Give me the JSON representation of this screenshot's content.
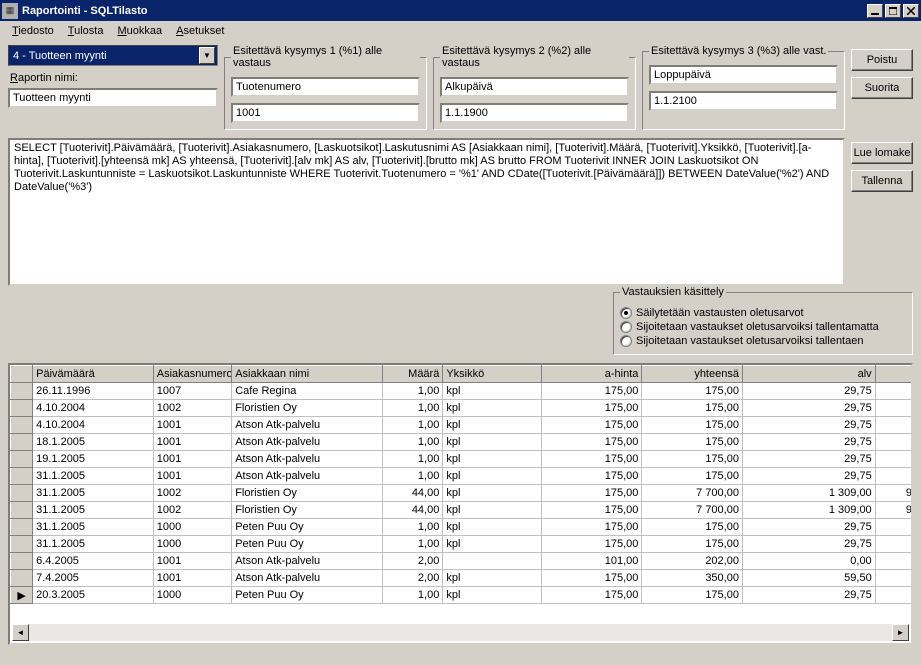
{
  "window": {
    "title": "Raportointi - SQLTilasto"
  },
  "menu": {
    "file": "iedosto",
    "file_u": "T",
    "output": "ulosta",
    "output_u": "T",
    "edit": "uokkaa",
    "edit_u": "M",
    "settings": "setukset",
    "settings_u": "A"
  },
  "report_selector": {
    "value": "4 - Tuotteen myynti"
  },
  "report_name": {
    "label": "aportin nimi:",
    "label_u": "R",
    "value": "Tuotteen myynti"
  },
  "q1": {
    "legend": "Esitettävä kysymys 1 (%1) alle vastaus",
    "prompt": "Tuotenumero",
    "value": "1001"
  },
  "q2": {
    "legend": "Esitettävä kysymys 2 (%2) alle vastaus",
    "prompt": "Alkupäivä",
    "value": "1.1.1900"
  },
  "q3": {
    "legend": "Esitettävä kysymys 3 (%3) alle vast.",
    "prompt": "Loppupäivä",
    "value": "1.1.2100"
  },
  "buttons": {
    "exit": "Poistu",
    "run": "Suorita",
    "read": "Lue lomake",
    "save": "Tallenna"
  },
  "sql": "SELECT [Tuoterivit].Päivämäärä, [Tuoterivit].Asiakasnumero, [Laskuotsikot].Laskutusnimi AS [Asiakkaan nimi], [Tuoterivit].Määrä, [Tuoterivit].Yksikkö, [Tuoterivit].[a-hinta], [Tuoterivit].[yhteensä mk] AS yhteensä, [Tuoterivit].[alv mk] AS alv, [Tuoterivit].[brutto mk] AS brutto FROM Tuoterivit INNER JOIN Laskuotsikot ON Tuoterivit.Laskuntunniste = Laskuotsikot.Laskuntunniste WHERE Tuoterivit.Tuotenumero = '%1' AND CDate([Tuoterivit.[Päivämäärä]]) BETWEEN DateValue('%2') AND DateValue('%3')",
  "answers_group": {
    "legend": "Vastauksien käsittely",
    "opt1": "Säilytetään vastausten oletusarvot",
    "opt2": "Sijoitetaan vastaukset oletusarvoiksi tallentamatta",
    "opt3": "Sijoitetaan vastaukset oletusarvoiksi tallentaen",
    "selected": 0
  },
  "grid": {
    "columns": [
      {
        "key": "date",
        "label": "Päivämäärä",
        "w": 120,
        "align": "left"
      },
      {
        "key": "cust",
        "label": "Asiakasnumero",
        "w": 78,
        "align": "left"
      },
      {
        "key": "name",
        "label": "Asiakkaan nimi",
        "w": 150,
        "align": "left"
      },
      {
        "key": "qty",
        "label": "Määrä",
        "w": 60,
        "align": "right"
      },
      {
        "key": "unit",
        "label": "Yksikkö",
        "w": 98,
        "align": "left"
      },
      {
        "key": "price",
        "label": "a-hinta",
        "w": 100,
        "align": "right"
      },
      {
        "key": "total",
        "label": "yhteensä",
        "w": 100,
        "align": "right"
      },
      {
        "key": "vat",
        "label": "alv",
        "w": 132,
        "align": "right"
      },
      {
        "key": "extra",
        "label": "",
        "w": 40,
        "align": "right"
      }
    ],
    "rows": [
      {
        "date": "26.11.1996",
        "cust": "1007",
        "name": "Cafe Regina",
        "qty": "1,00",
        "unit": "kpl",
        "price": "175,00",
        "total": "175,00",
        "vat": "29,75",
        "extra": ""
      },
      {
        "date": "4.10.2004",
        "cust": "1002",
        "name": "Floristien Oy",
        "qty": "1,00",
        "unit": "kpl",
        "price": "175,00",
        "total": "175,00",
        "vat": "29,75",
        "extra": ""
      },
      {
        "date": "4.10.2004",
        "cust": "1001",
        "name": "Atson Atk-palvelu",
        "qty": "1,00",
        "unit": "kpl",
        "price": "175,00",
        "total": "175,00",
        "vat": "29,75",
        "extra": ""
      },
      {
        "date": "18.1.2005",
        "cust": "1001",
        "name": "Atson Atk-palvelu",
        "qty": "1,00",
        "unit": "kpl",
        "price": "175,00",
        "total": "175,00",
        "vat": "29,75",
        "extra": ""
      },
      {
        "date": "19.1.2005",
        "cust": "1001",
        "name": "Atson Atk-palvelu",
        "qty": "1,00",
        "unit": "kpl",
        "price": "175,00",
        "total": "175,00",
        "vat": "29,75",
        "extra": ""
      },
      {
        "date": "31.1.2005",
        "cust": "1001",
        "name": "Atson Atk-palvelu",
        "qty": "1,00",
        "unit": "kpl",
        "price": "175,00",
        "total": "175,00",
        "vat": "29,75",
        "extra": ""
      },
      {
        "date": "31.1.2005",
        "cust": "1002",
        "name": "Floristien Oy",
        "qty": "44,00",
        "unit": "kpl",
        "price": "175,00",
        "total": "7 700,00",
        "vat": "1 309,00",
        "extra": "9"
      },
      {
        "date": "31.1.2005",
        "cust": "1002",
        "name": "Floristien Oy",
        "qty": "44,00",
        "unit": "kpl",
        "price": "175,00",
        "total": "7 700,00",
        "vat": "1 309,00",
        "extra": "9"
      },
      {
        "date": "31.1.2005",
        "cust": "1000",
        "name": "Peten Puu Oy",
        "qty": "1,00",
        "unit": "kpl",
        "price": "175,00",
        "total": "175,00",
        "vat": "29,75",
        "extra": ""
      },
      {
        "date": "31.1.2005",
        "cust": "1000",
        "name": "Peten Puu Oy",
        "qty": "1,00",
        "unit": "kpl",
        "price": "175,00",
        "total": "175,00",
        "vat": "29,75",
        "extra": ""
      },
      {
        "date": "6.4.2005",
        "cust": "1001",
        "name": "Atson Atk-palvelu",
        "qty": "2,00",
        "unit": "",
        "price": "101,00",
        "total": "202,00",
        "vat": "0,00",
        "extra": ""
      },
      {
        "date": "7.4.2005",
        "cust": "1001",
        "name": "Atson Atk-palvelu",
        "qty": "2,00",
        "unit": "kpl",
        "price": "175,00",
        "total": "350,00",
        "vat": "59,50",
        "extra": ""
      },
      {
        "date": "20.3.2005",
        "cust": "1000",
        "name": "Peten Puu Oy",
        "qty": "1,00",
        "unit": "kpl",
        "price": "175,00",
        "total": "175,00",
        "vat": "29,75",
        "extra": ""
      }
    ],
    "current_row": 12
  }
}
